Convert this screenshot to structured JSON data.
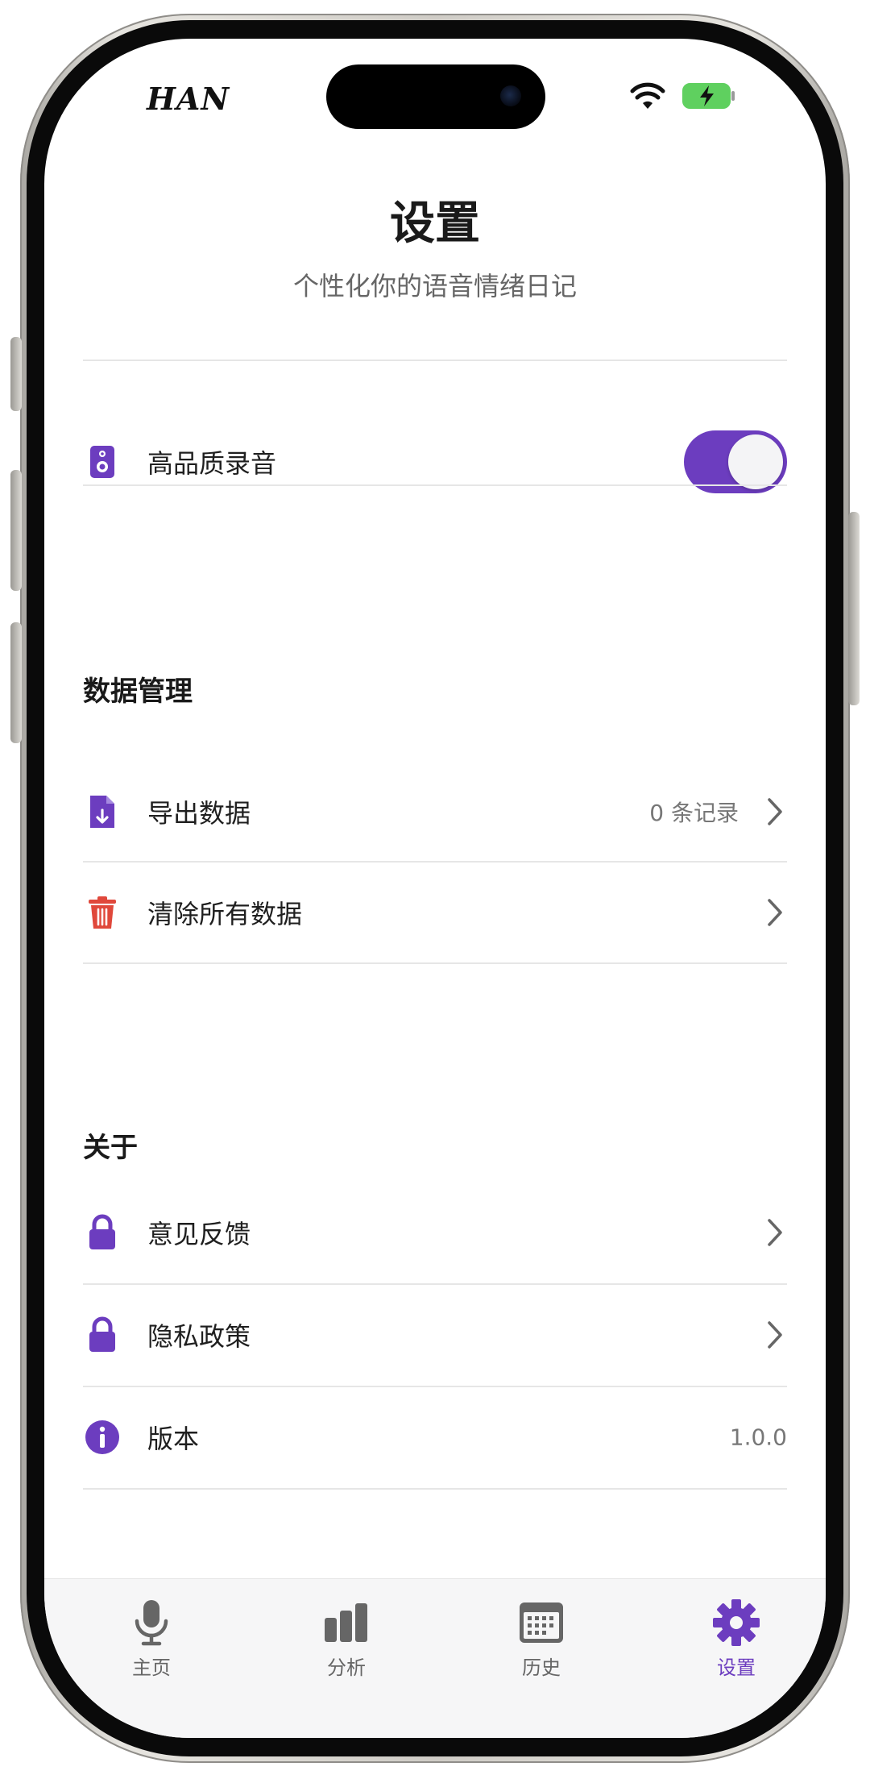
{
  "status_bar": {
    "carrier": "HAN"
  },
  "header": {
    "title": "设置",
    "subtitle": "个性化你的语音情绪日记"
  },
  "settings": {
    "hq_recording": {
      "label": "高品质录音",
      "enabled": true,
      "icon": "speaker-icon"
    }
  },
  "data_management": {
    "title": "数据管理",
    "items": [
      {
        "label": "导出数据",
        "value": "0 条记录",
        "icon": "file-export-icon"
      },
      {
        "label": "清除所有数据",
        "value": "",
        "icon": "trash-icon"
      }
    ]
  },
  "about": {
    "title": "关于",
    "items": [
      {
        "label": "意见反馈",
        "icon": "lock-icon"
      },
      {
        "label": "隐私政策",
        "icon": "lock-icon"
      },
      {
        "label": "版本",
        "value": "1.0.0",
        "icon": "info-icon"
      }
    ]
  },
  "tab_bar": {
    "tabs": [
      {
        "label": "主页",
        "icon": "microphone-icon"
      },
      {
        "label": "分析",
        "icon": "bar-chart-icon"
      },
      {
        "label": "历史",
        "icon": "calendar-icon"
      },
      {
        "label": "设置",
        "icon": "gear-icon"
      }
    ],
    "active_index": 3
  },
  "colors": {
    "accent": "#6c3dbf",
    "danger": "#e0483b",
    "tab_inactive": "#666666"
  }
}
